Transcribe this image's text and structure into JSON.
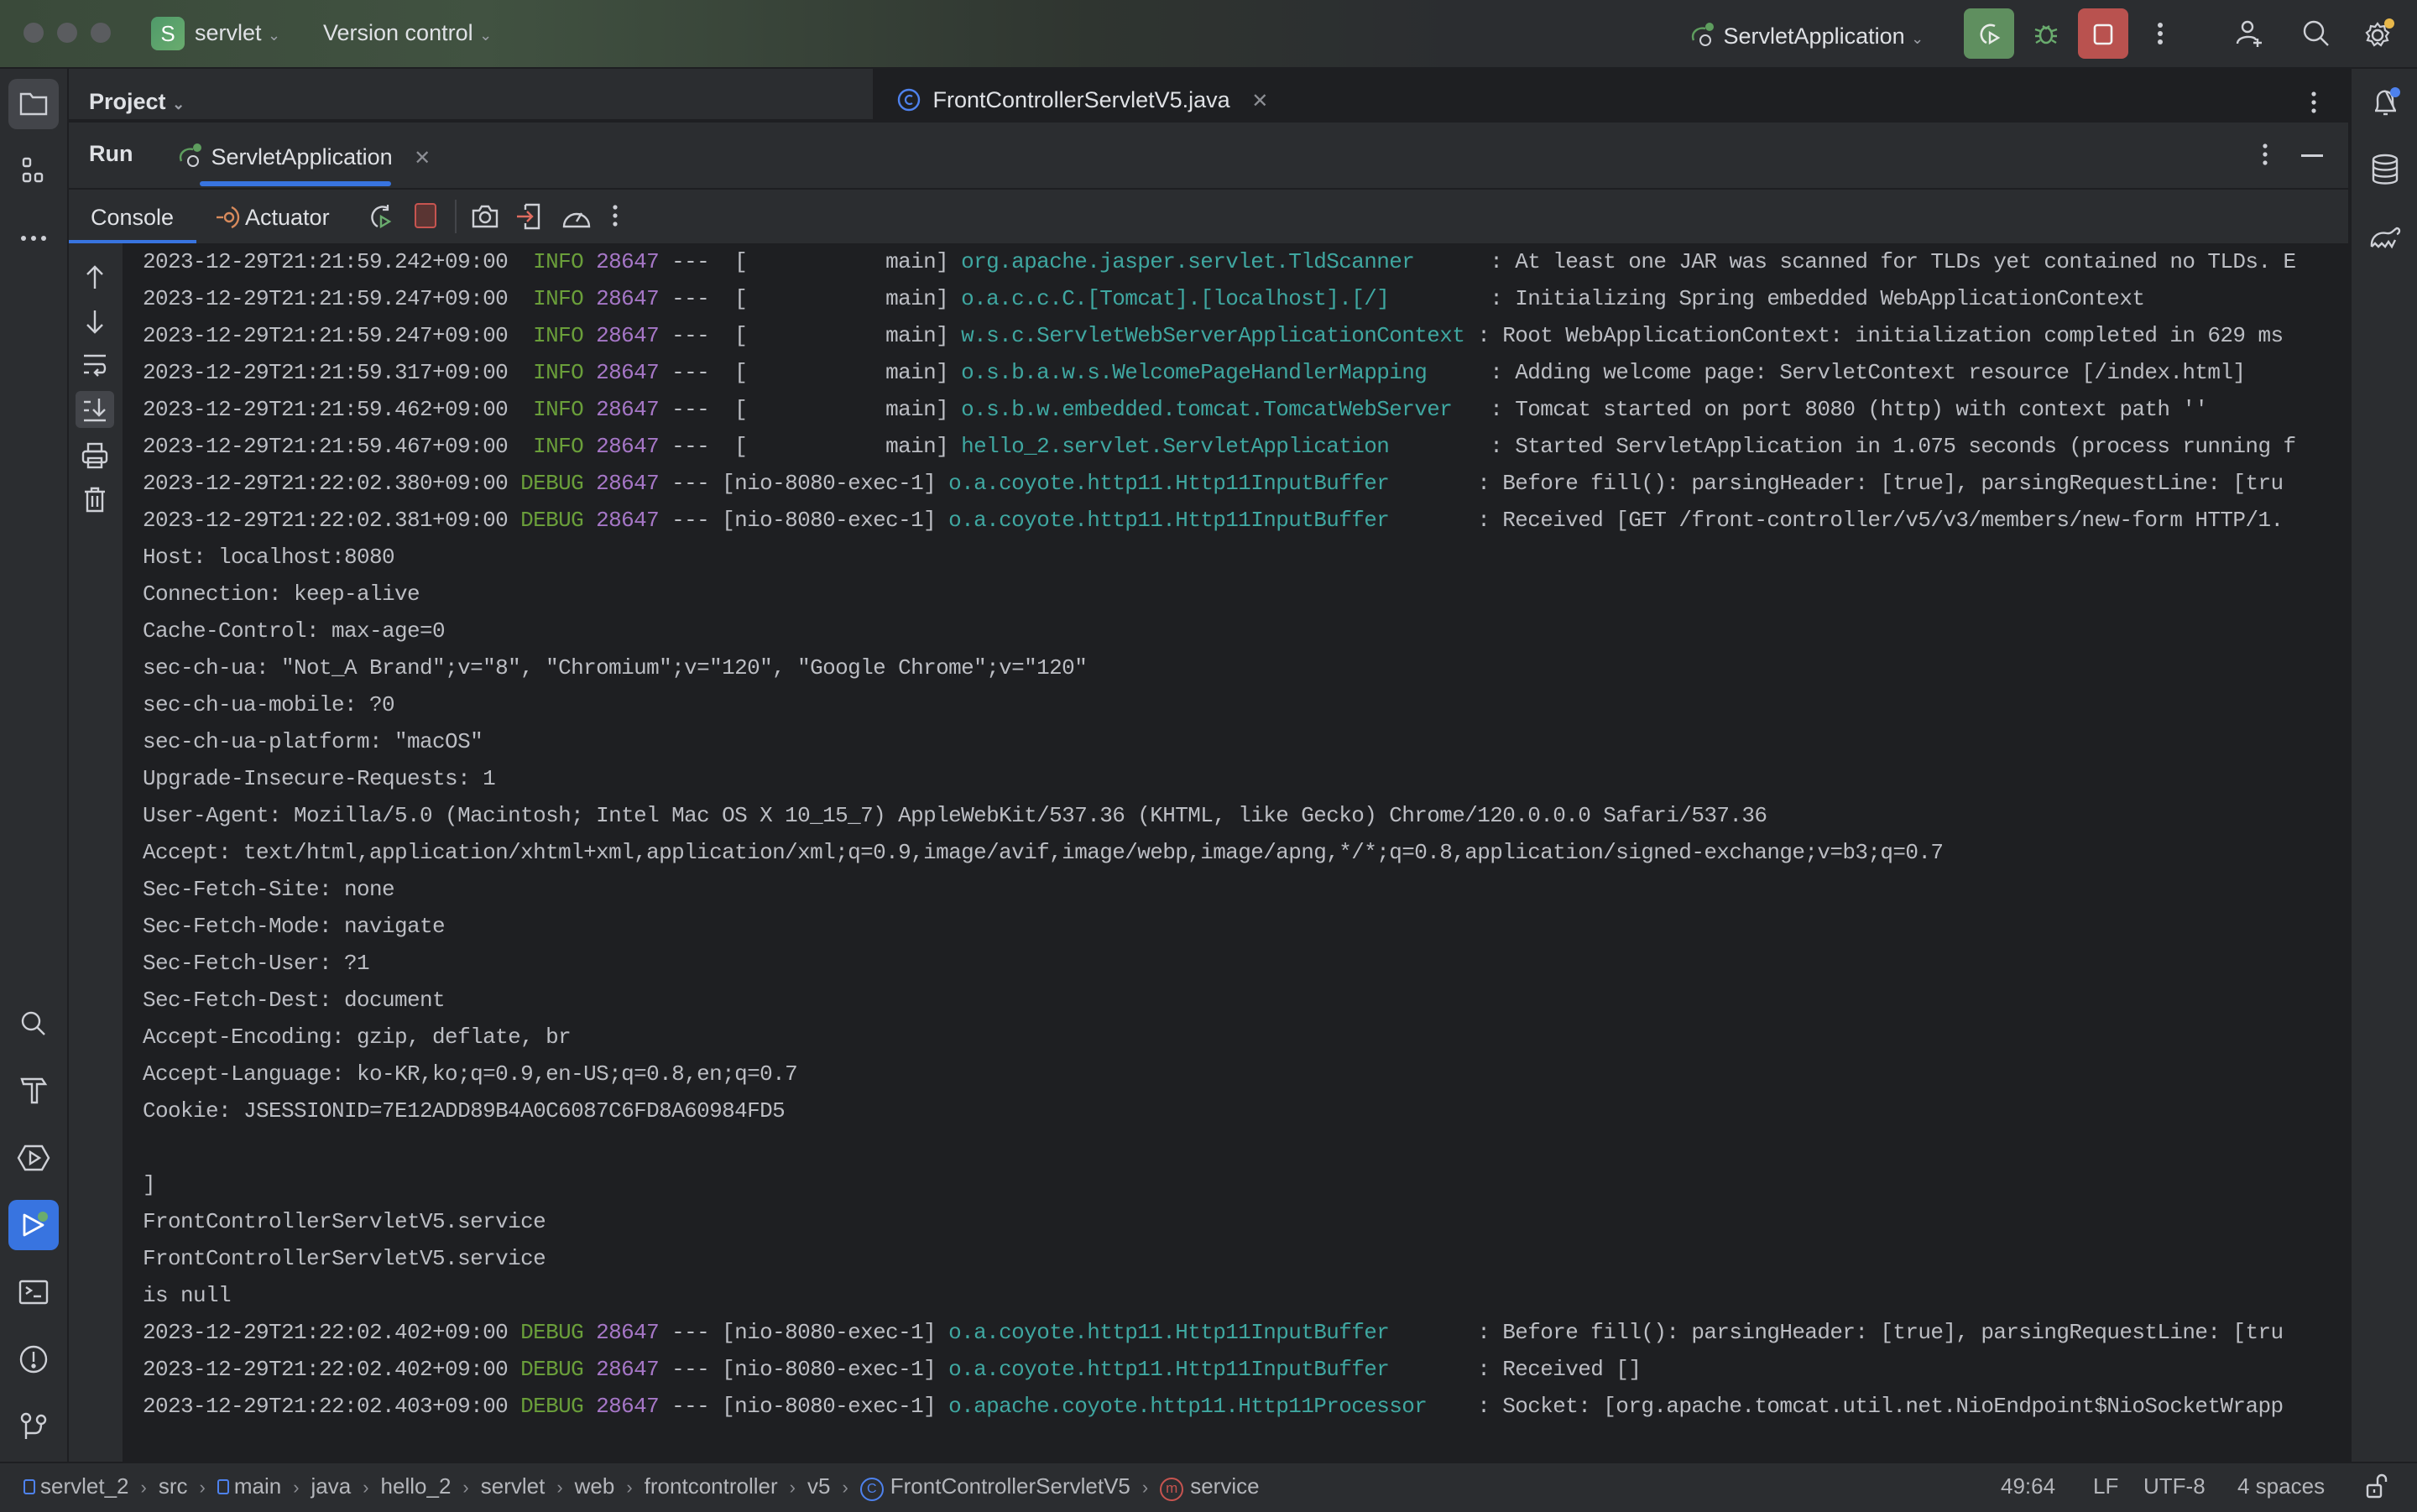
{
  "titlebar": {
    "project_badge": "S",
    "project_name": "servlet",
    "vcs_label": "Version control",
    "run_config": "ServletApplication",
    "accent_run": "#5f8f5f",
    "accent_stop": "#b9524f"
  },
  "project_panel": {
    "title": "Project"
  },
  "editor": {
    "tab_label": "FrontControllerServletV5.java"
  },
  "run_window": {
    "title": "Run",
    "tab_label": "ServletApplication",
    "subtabs": [
      "Console",
      "Actuator"
    ]
  },
  "console": {
    "log_lines": [
      {
        "ts": "2023-12-29T21:21:59.242+09:00",
        "lvl": " INFO",
        "pid": "28647",
        "thread": "---  [           main]",
        "logger": "org.apache.jasper.servlet.TldScanner     ",
        "msg": " : At least one JAR was scanned for TLDs yet contained no TLDs. E"
      },
      {
        "ts": "2023-12-29T21:21:59.247+09:00",
        "lvl": " INFO",
        "pid": "28647",
        "thread": "---  [           main]",
        "logger": "o.a.c.c.C.[Tomcat].[localhost].[/]       ",
        "msg": " : Initializing Spring embedded WebApplicationContext"
      },
      {
        "ts": "2023-12-29T21:21:59.247+09:00",
        "lvl": " INFO",
        "pid": "28647",
        "thread": "---  [           main]",
        "logger": "w.s.c.ServletWebServerApplicationContext ",
        "msg": ": Root WebApplicationContext: initialization completed in 629 ms"
      },
      {
        "ts": "2023-12-29T21:21:59.317+09:00",
        "lvl": " INFO",
        "pid": "28647",
        "thread": "---  [           main]",
        "logger": "o.s.b.a.w.s.WelcomePageHandlerMapping    ",
        "msg": " : Adding welcome page: ServletContext resource [/index.html]"
      },
      {
        "ts": "2023-12-29T21:21:59.462+09:00",
        "lvl": " INFO",
        "pid": "28647",
        "thread": "---  [           main]",
        "logger": "o.s.b.w.embedded.tomcat.TomcatWebServer  ",
        "msg": " : Tomcat started on port 8080 (http) with context path ''"
      },
      {
        "ts": "2023-12-29T21:21:59.467+09:00",
        "lvl": " INFO",
        "pid": "28647",
        "thread": "---  [           main]",
        "logger": "hello_2.servlet.ServletApplication       ",
        "msg": " : Started ServletApplication in 1.075 seconds (process running f"
      },
      {
        "ts": "2023-12-29T21:22:02.380+09:00",
        "lvl": "DEBUG",
        "pid": "28647",
        "thread": "--- [nio-8080-exec-1]",
        "logger": "o.a.coyote.http11.Http11InputBuffer      ",
        "msg": " : Before fill(): parsingHeader: [true], parsingRequestLine: [tru"
      },
      {
        "ts": "2023-12-29T21:22:02.381+09:00",
        "lvl": "DEBUG",
        "pid": "28647",
        "thread": "--- [nio-8080-exec-1]",
        "logger": "o.a.coyote.http11.Http11InputBuffer      ",
        "msg": " : Received [GET /front-controller/v5/v3/members/new-form HTTP/1."
      }
    ],
    "plain_lines": [
      "Host: localhost:8080",
      "Connection: keep-alive",
      "Cache-Control: max-age=0",
      "sec-ch-ua: \"Not_A Brand\";v=\"8\", \"Chromium\";v=\"120\", \"Google Chrome\";v=\"120\"",
      "sec-ch-ua-mobile: ?0",
      "sec-ch-ua-platform: \"macOS\"",
      "Upgrade-Insecure-Requests: 1",
      "User-Agent: Mozilla/5.0 (Macintosh; Intel Mac OS X 10_15_7) AppleWebKit/537.36 (KHTML, like Gecko) Chrome/120.0.0.0 Safari/537.36",
      "Accept: text/html,application/xhtml+xml,application/xml;q=0.9,image/avif,image/webp,image/apng,*/*;q=0.8,application/signed-exchange;v=b3;q=0.7",
      "Sec-Fetch-Site: none",
      "Sec-Fetch-Mode: navigate",
      "Sec-Fetch-User: ?1",
      "Sec-Fetch-Dest: document",
      "Accept-Encoding: gzip, deflate, br",
      "Accept-Language: ko-KR,ko;q=0.9,en-US;q=0.8,en;q=0.7",
      "Cookie: JSESSIONID=7E12ADD89B4A0C6087C6FD8A60984FD5",
      "",
      "]",
      "FrontControllerServletV5.service",
      "FrontControllerServletV5.service",
      "is null"
    ],
    "tail_lines": [
      {
        "ts": "2023-12-29T21:22:02.402+09:00",
        "lvl": "DEBUG",
        "pid": "28647",
        "thread": "--- [nio-8080-exec-1]",
        "logger": "o.a.coyote.http11.Http11InputBuffer      ",
        "msg": " : Before fill(): parsingHeader: [true], parsingRequestLine: [tru"
      },
      {
        "ts": "2023-12-29T21:22:02.402+09:00",
        "lvl": "DEBUG",
        "pid": "28647",
        "thread": "--- [nio-8080-exec-1]",
        "logger": "o.a.coyote.http11.Http11InputBuffer      ",
        "msg": " : Received []"
      },
      {
        "ts": "2023-12-29T21:22:02.403+09:00",
        "lvl": "DEBUG",
        "pid": "28647",
        "thread": "--- [nio-8080-exec-1]",
        "logger": "o.apache.coyote.http11.Http11Processor   ",
        "msg": " : Socket: [org.apache.tomcat.util.net.NioEndpoint$NioSocketWrapp"
      }
    ]
  },
  "statusbar": {
    "breadcrumbs": [
      "servlet_2",
      "src",
      "main",
      "java",
      "hello_2",
      "servlet",
      "web",
      "frontcontroller",
      "v5",
      "FrontControllerServletV5",
      "service"
    ],
    "position": "49:64",
    "line_sep": "LF",
    "encoding": "UTF-8",
    "indent": "4 spaces"
  }
}
